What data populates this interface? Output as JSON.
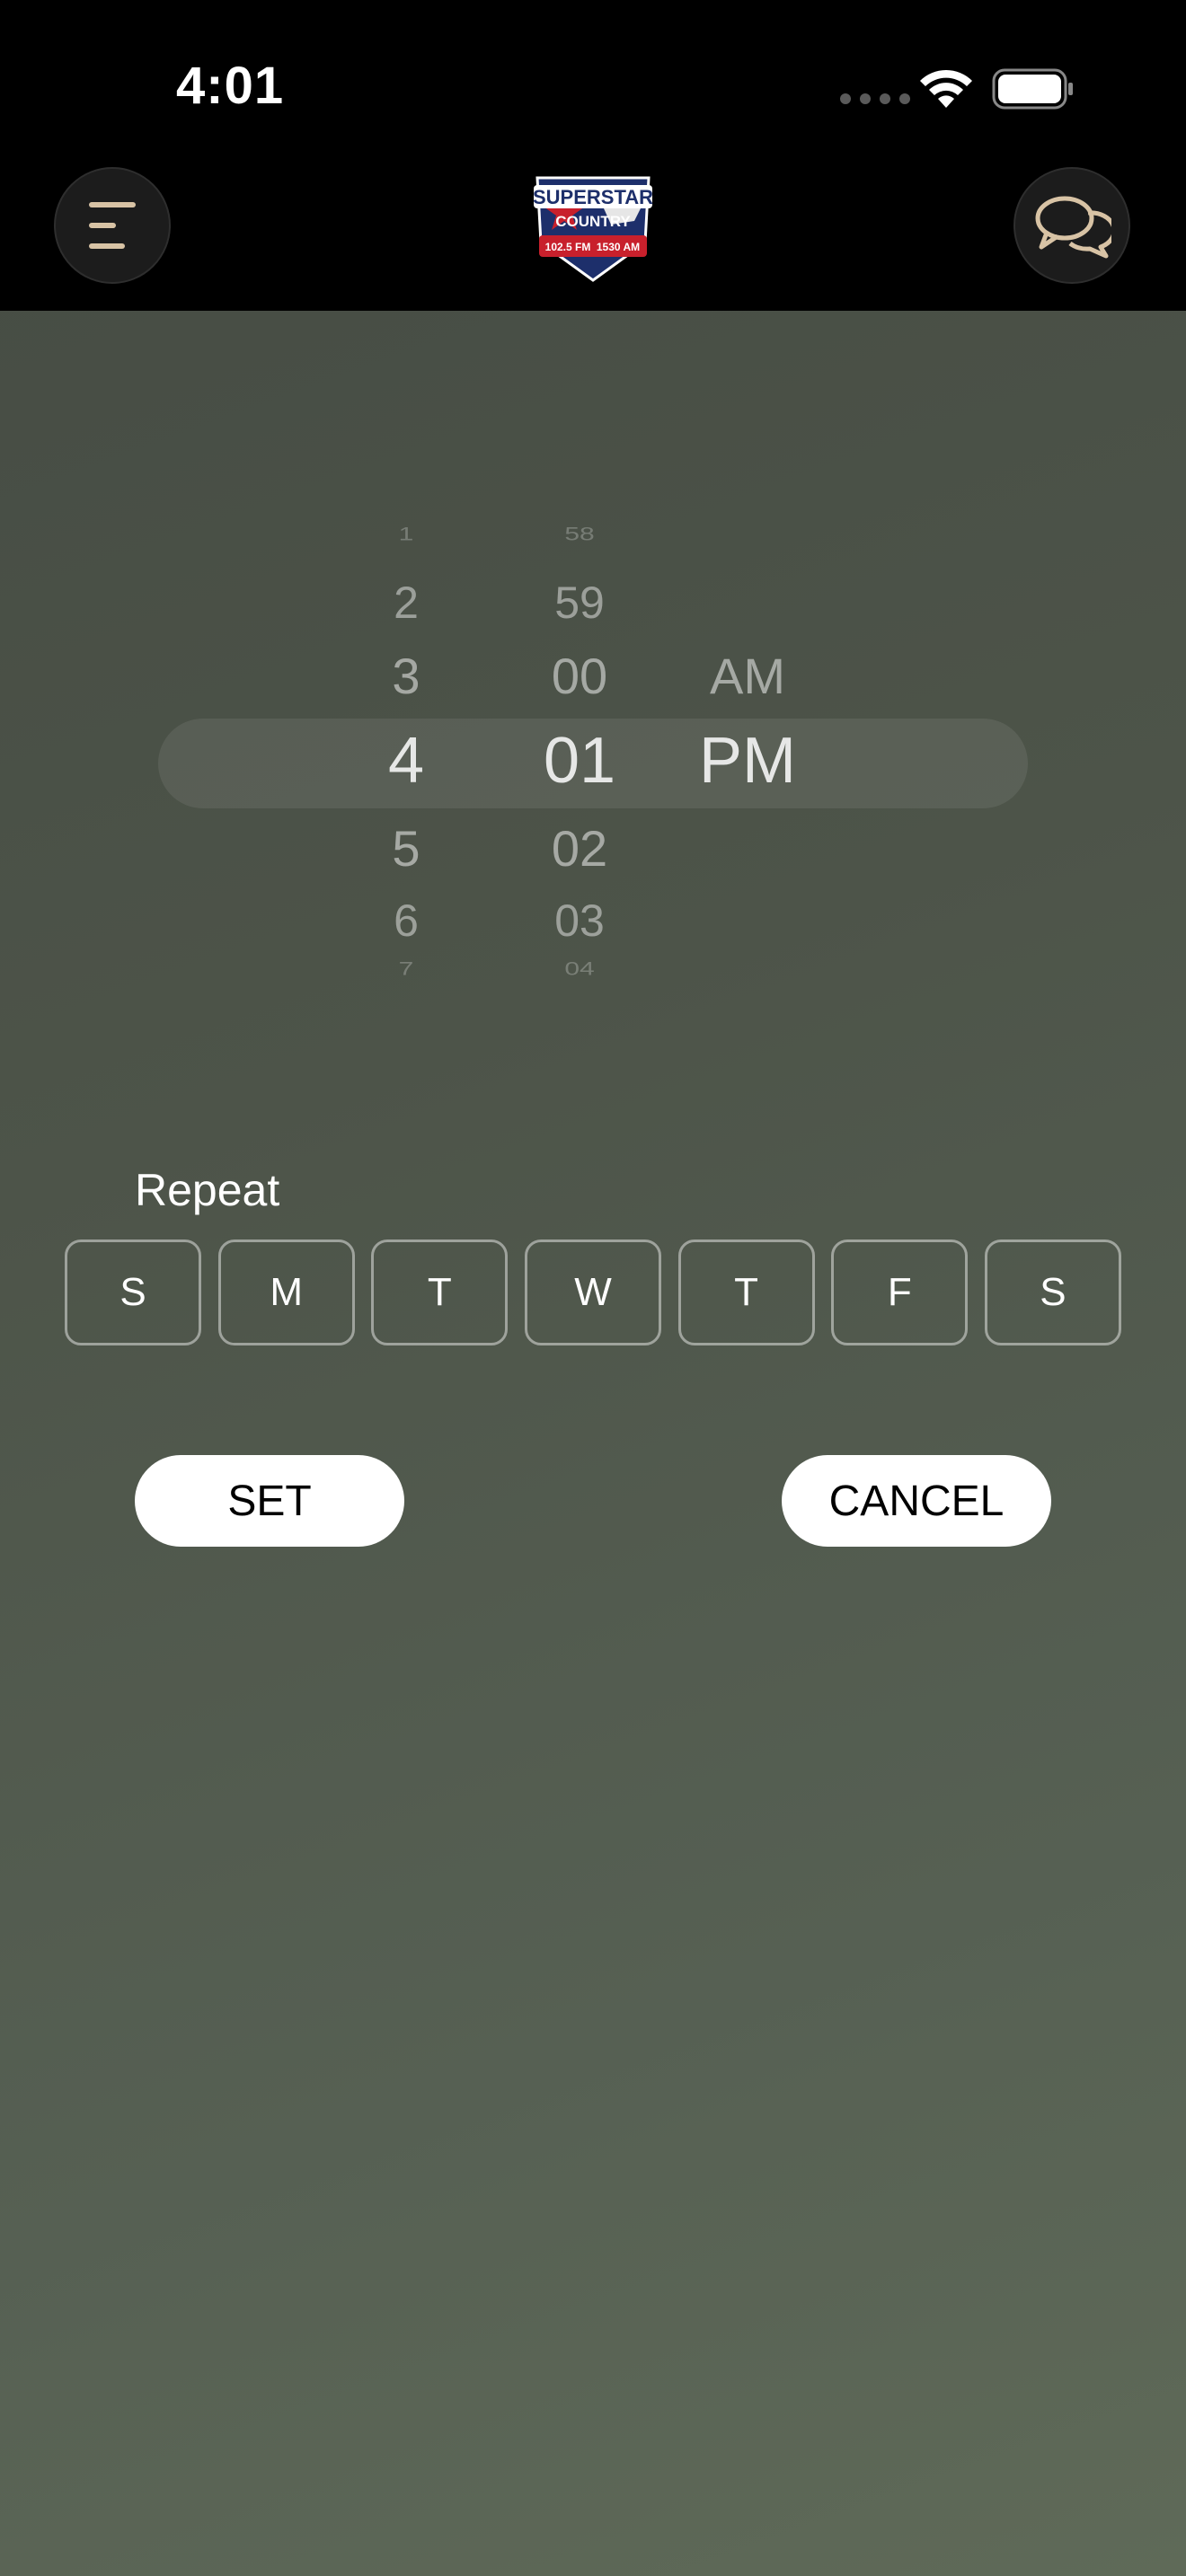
{
  "status_bar": {
    "time": "4:01"
  },
  "header": {
    "menu_icon": "menu-lines-icon",
    "chat_icon": "chat-bubbles-icon",
    "logo": {
      "line1": "SUPERSTAR",
      "line2": "COUNTRY",
      "freq1": "102.5 FM",
      "freq2": "1530 AM"
    }
  },
  "time_picker": {
    "hours": {
      "faint_above": "1",
      "above2": "2",
      "above1": "3",
      "selected": "4",
      "below1": "5",
      "below2": "6",
      "faint_below": "7"
    },
    "minutes": {
      "faint_above": "58",
      "above2": "59",
      "above1": "00",
      "selected": "01",
      "below1": "02",
      "below2": "03",
      "faint_below": "04"
    },
    "period": {
      "above1": "AM",
      "selected": "PM"
    }
  },
  "repeat": {
    "label": "Repeat",
    "days": [
      "S",
      "M",
      "T",
      "W",
      "T",
      "F",
      "S"
    ]
  },
  "actions": {
    "set_label": "SET",
    "cancel_label": "CANCEL"
  },
  "colors": {
    "header_bg": "#000000",
    "accent_icon": "#d8c3a5",
    "button_bg": "#ffffff"
  }
}
